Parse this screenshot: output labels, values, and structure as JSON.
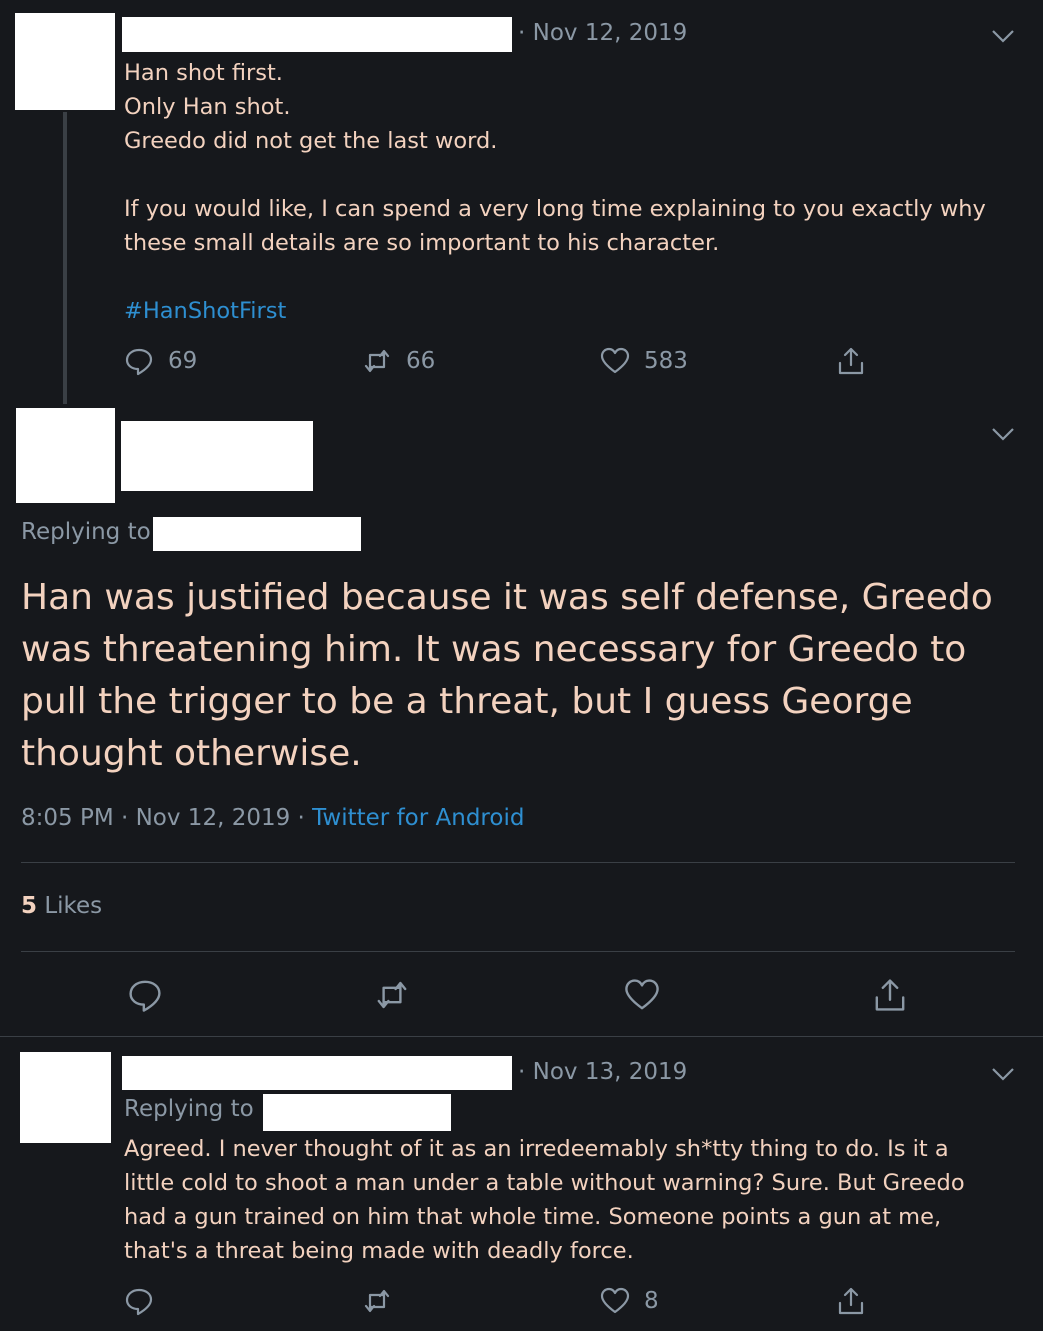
{
  "tweet1": {
    "date": "· Nov 12, 2019",
    "text": "Han shot first.\nOnly Han shot.\nGreedo did not get the last word.\n\nIf you would like, I can spend a very long time explaining to you exactly why\nthese small details are so important to his character.",
    "hashtag": "#HanShotFirst",
    "replies": "69",
    "retweets": "66",
    "likes": "583"
  },
  "tweet2": {
    "replying_to": "Replying to",
    "text": "Han was justified because it was self defense, Greedo was threatening him. It was necessary for Greedo to pull the trigger to be a threat, but I guess George thought otherwise.",
    "time": "8:05 PM · Nov 12, 2019 · ",
    "source": "Twitter for Android",
    "likes_count": "5",
    "likes_label": " Likes"
  },
  "tweet3": {
    "date": "· Nov 13, 2019",
    "replying_to": "Replying to",
    "text": "Agreed. I never thought of it as an irredeemably sh*tty thing to do. Is it a\nlittle cold to shoot a man under a table without warning? Sure. But Greedo\nhad a gun trained on him that whole time. Someone points a gun at me,\nthat's a threat being made with deadly force.",
    "likes": "8"
  },
  "icons": [
    "chevron-down-icon",
    "reply-icon",
    "retweet-icon",
    "heart-icon",
    "share-icon"
  ],
  "colors": {
    "background": "#16181c",
    "text": "#f3d2bf",
    "muted": "#8b98a5",
    "link": "#2e8fd1",
    "redaction": "#ffffff"
  }
}
